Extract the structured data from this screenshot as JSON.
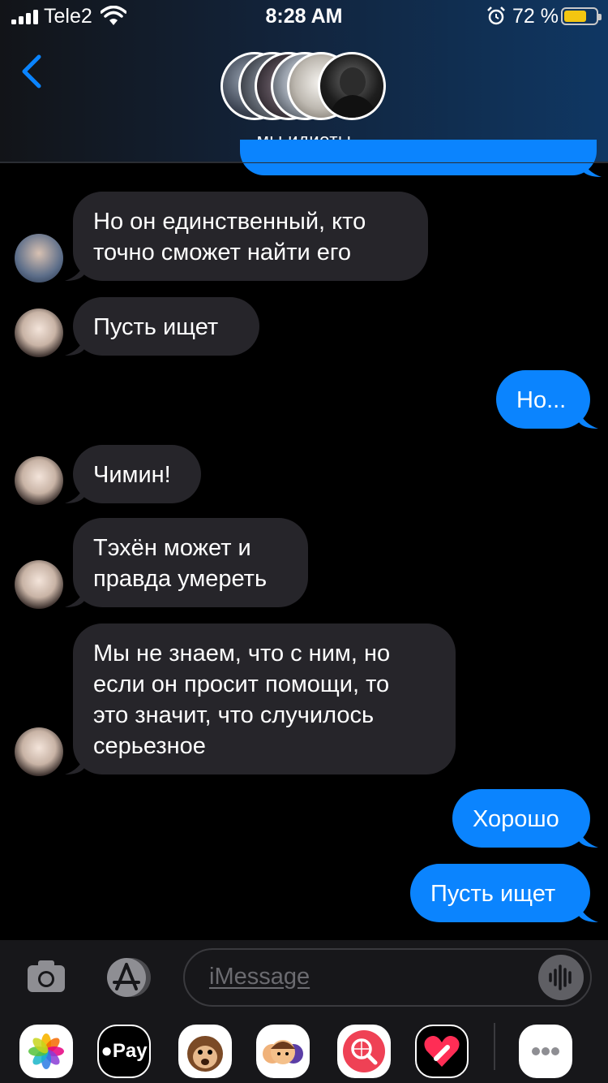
{
  "status": {
    "carrier": "Tele2",
    "time": "8:28 AM",
    "battery_pct": "72 %",
    "battery_level": 0.72
  },
  "header": {
    "group_name": "мы идиоты"
  },
  "messages": [
    {
      "dir": "in",
      "lines": [
        "Но он единственный, кто",
        "точно сможет найти его"
      ],
      "avatar": "avatar-member-1"
    },
    {
      "dir": "in",
      "lines": [
        "Пусть ищет"
      ],
      "avatar": "avatar-member-2"
    },
    {
      "dir": "out",
      "lines": [
        "Но..."
      ]
    },
    {
      "dir": "in",
      "lines": [
        "Чимин!"
      ],
      "avatar": "avatar-member-2"
    },
    {
      "dir": "in",
      "lines": [
        "Тэхён может и",
        "правда умереть"
      ],
      "avatar": "avatar-member-2"
    },
    {
      "dir": "in",
      "lines": [
        "Мы не знаем, что с ним, но",
        "если он просит помощи, то",
        "это значит, что случилось",
        "серьезное"
      ],
      "avatar": "avatar-member-2"
    },
    {
      "dir": "out",
      "lines": [
        "Хорошо"
      ]
    },
    {
      "dir": "out",
      "lines": [
        "Пусть ищет"
      ]
    }
  ],
  "composer": {
    "placeholder": "iMessage"
  },
  "apps": [
    {
      "name": "photos-app-icon"
    },
    {
      "name": "apple-pay-app-icon",
      "label": "Pay"
    },
    {
      "name": "animoji-app-icon"
    },
    {
      "name": "memoji-app-icon"
    },
    {
      "name": "web-search-app-icon"
    },
    {
      "name": "digital-touch-app-icon"
    },
    {
      "name": "more-apps-icon"
    }
  ],
  "colors": {
    "outgoing_bubble": "#0b84fe",
    "incoming_bubble": "#26252a",
    "accent": "#0a84ff"
  }
}
